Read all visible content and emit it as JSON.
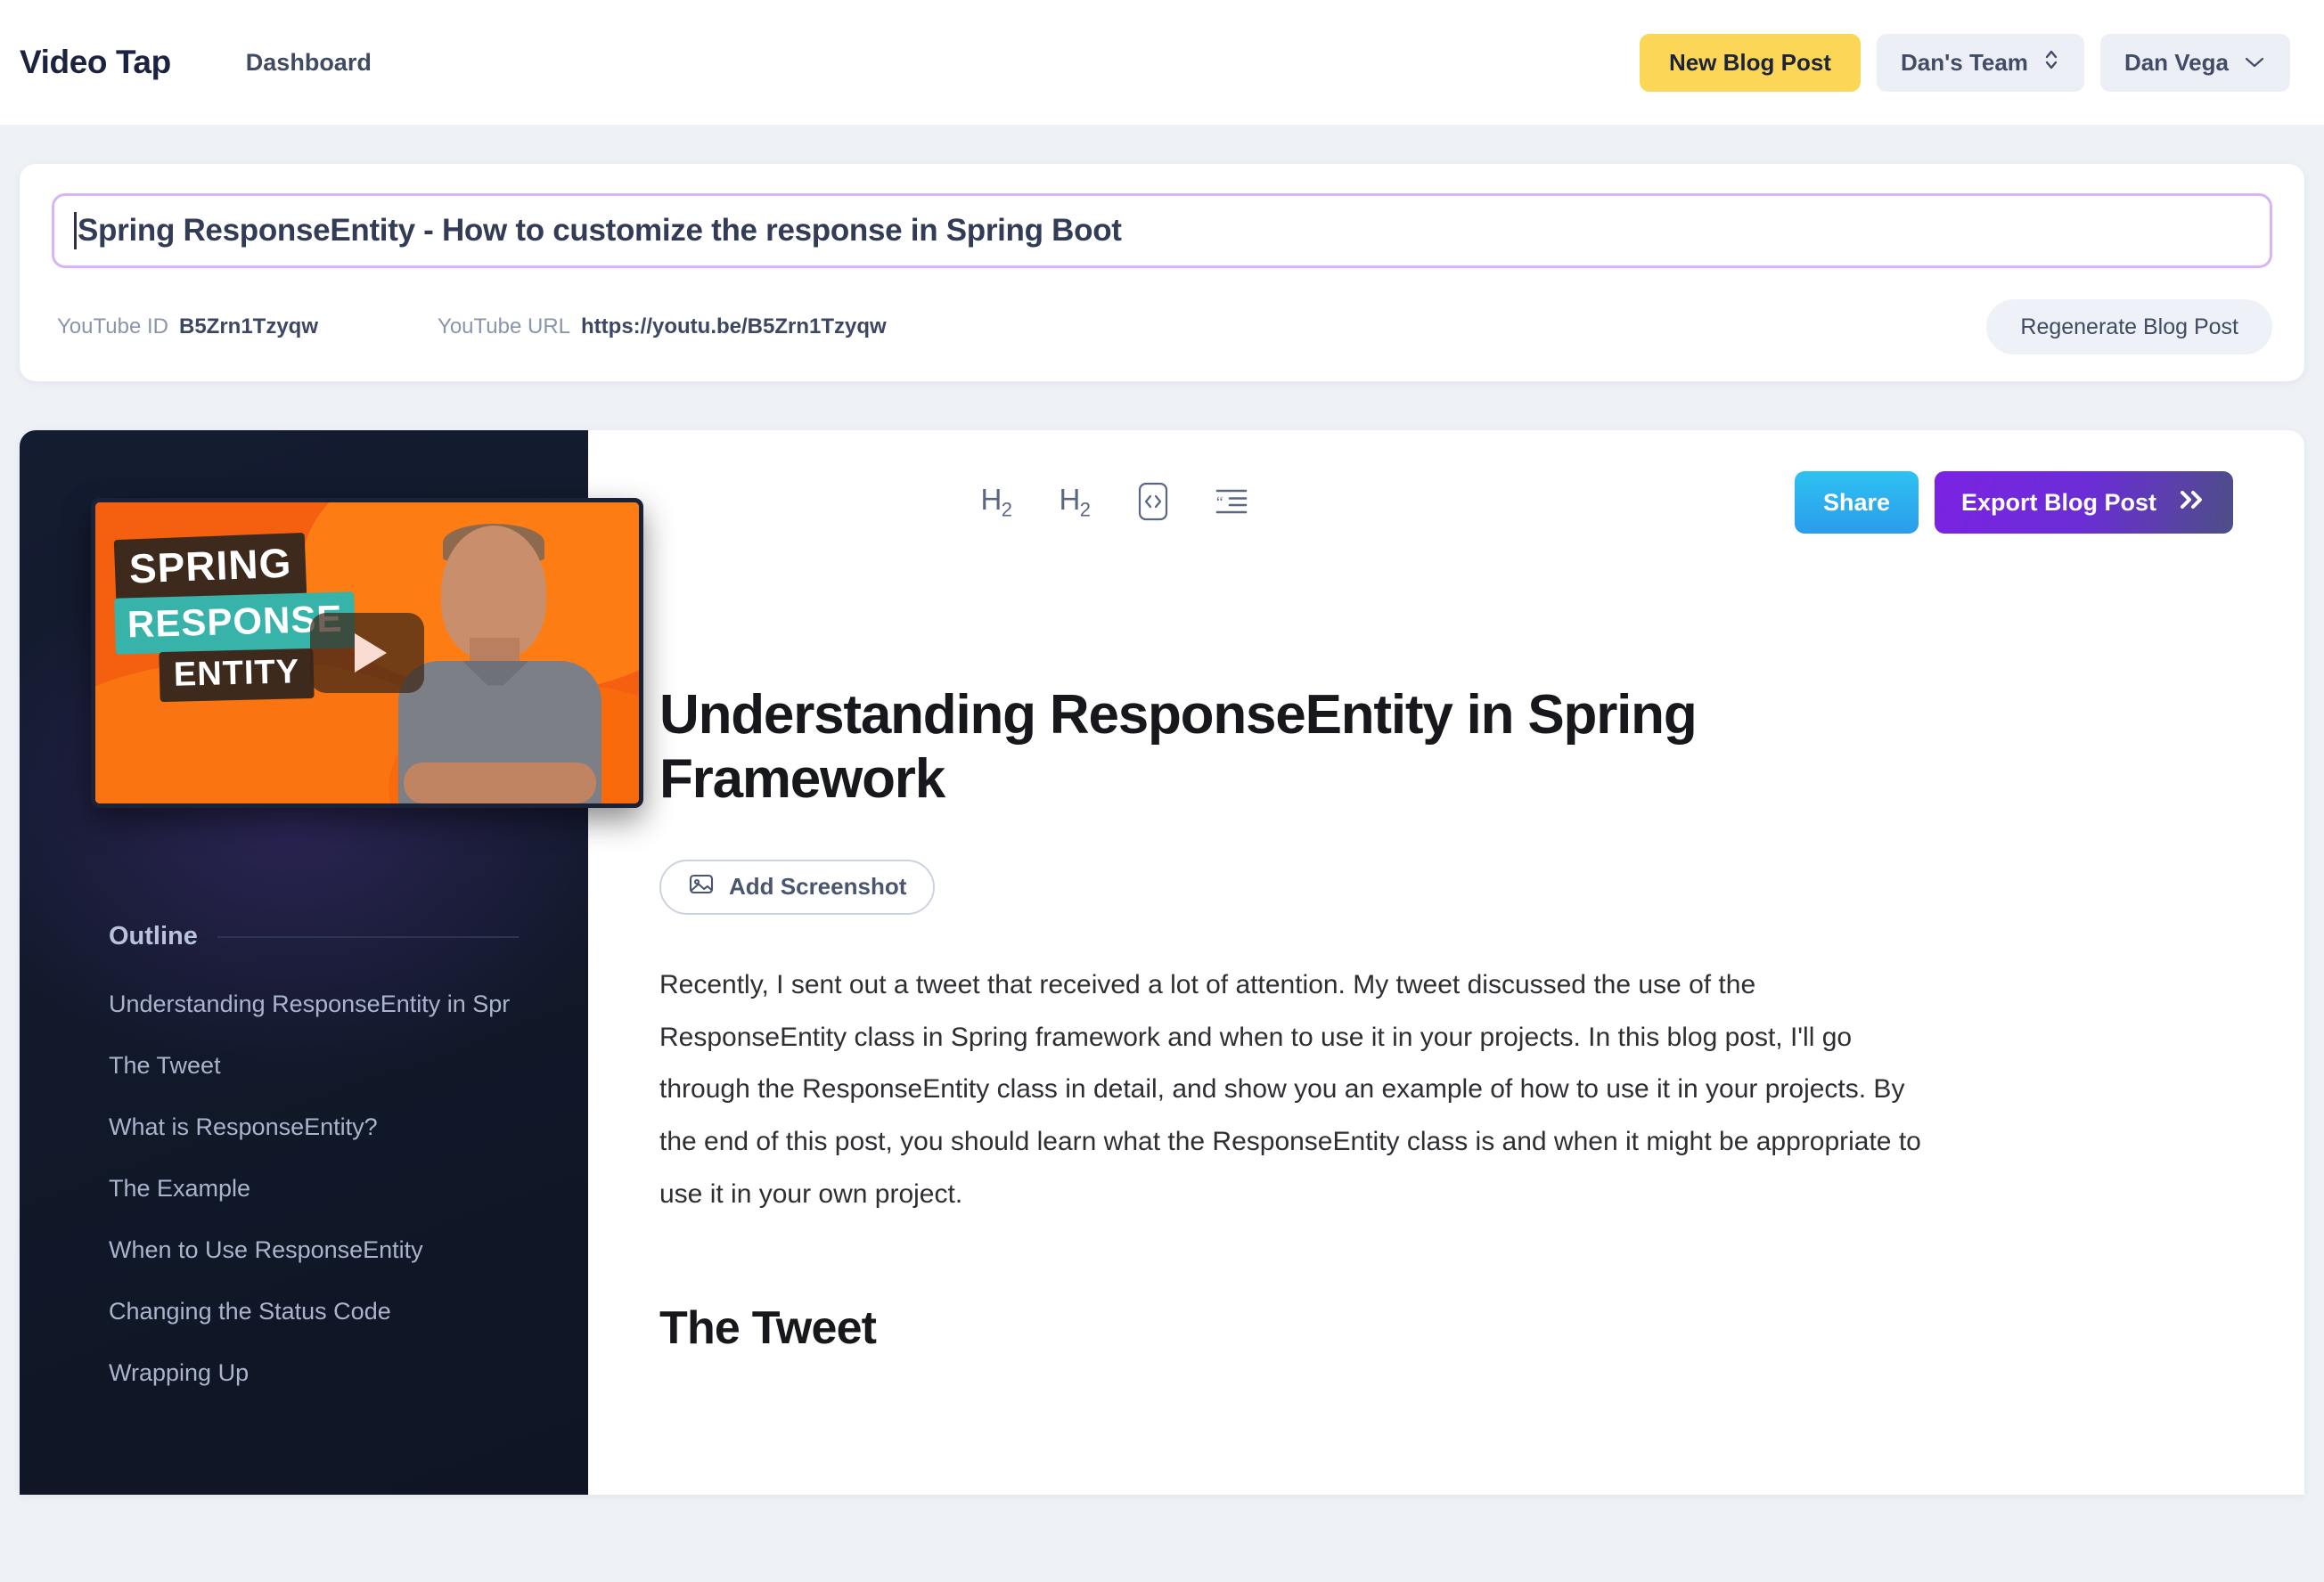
{
  "header": {
    "brand": "Video Tap",
    "nav_dashboard": "Dashboard",
    "new_post_label": "New Blog Post",
    "team_label": "Dan's Team",
    "user_label": "Dan Vega",
    "accent_yellow": "#fcd757",
    "pill_bg": "#eceff5"
  },
  "meta_card": {
    "title_value": "Spring ResponseEntity -  How to customize the response in Spring Boot",
    "title_placeholder": "Blog post title",
    "youtube_id_label": "YouTube ID",
    "youtube_id_value": "B5Zrn1Tzyqw",
    "youtube_url_label": "YouTube URL",
    "youtube_url_value": "https://youtu.be/B5Zrn1Tzyqw",
    "regenerate_label": "Regenerate Blog Post",
    "border_color": "#d6b4f5"
  },
  "sidebar": {
    "video_title_lines": [
      "SPRING",
      "RESPONSE",
      "ENTITY"
    ],
    "outline_heading": "Outline",
    "outline_items": [
      {
        "label": "Understanding ResponseEntity in Spr"
      },
      {
        "label": "The Tweet"
      },
      {
        "label": "What is ResponseEntity?"
      },
      {
        "label": "The Example"
      },
      {
        "label": "When to Use ResponseEntity"
      },
      {
        "label": "Changing the Status Code"
      },
      {
        "label": "Wrapping Up"
      }
    ],
    "panel_bg": "#131a2e"
  },
  "toolbar": {
    "heading_2_a": "H",
    "heading_2_a_sub": "2",
    "heading_2_b": "H",
    "heading_2_b_sub": "2",
    "share_label": "Share",
    "export_label": "Export Blog Post",
    "share_color": "#2ab4ef",
    "export_color": "#7b22e2"
  },
  "document": {
    "h1": "Understanding ResponseEntity in Spring Framework",
    "add_screenshot_label": "Add Screenshot",
    "paragraph_1": "Recently, I sent out a tweet that received a lot of attention. My tweet discussed the use of the ResponseEntity class in Spring framework and when to use it in your projects. In this blog post, I'll go through the ResponseEntity class in detail, and show you an example of how to use it in your projects. By the end of this post, you should learn what the ResponseEntity class is and when it might be appropriate to use it in your own project.",
    "h2_the_tweet": "The Tweet"
  }
}
